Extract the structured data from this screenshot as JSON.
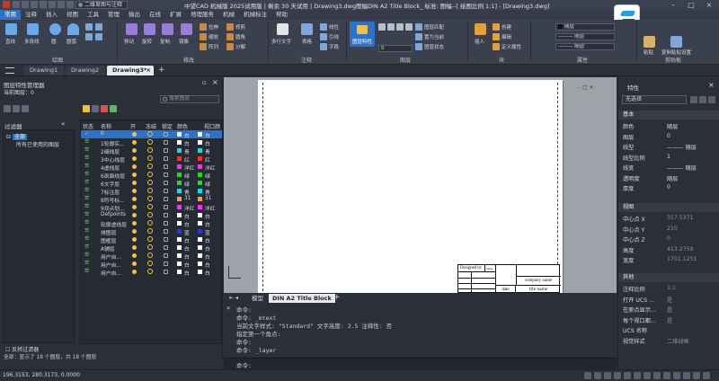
{
  "titlebar": {
    "workspace": "二维草图与注释",
    "title": "中望CAD 机械版 2025试用版 | 剩余 30 天试用 | Drawing3.dwg图幅DIN A2 Title Block_ 标准: 图幅--[ 绘图比例 1:1] - [Drawing3.dwg]"
  },
  "menu": [
    "常用",
    "注释",
    "插入",
    "视图",
    "工具",
    "管理",
    "输出",
    "在线",
    "扩展",
    "地理服务",
    "机械",
    "机械标注",
    "帮助"
  ],
  "ribbon": {
    "draw": {
      "label": "绘图",
      "buttons": [
        "直线",
        "多段线",
        "圆",
        "圆弧"
      ]
    },
    "modify": {
      "label": "修改",
      "buttons": [
        "移动",
        "旋转",
        "复制",
        "镜像",
        "拉伸",
        "缩放",
        "阵列",
        "修剪",
        "圆角",
        "分解"
      ]
    },
    "annotate": {
      "label": "注释",
      "buttons": [
        "多行文字",
        "表格",
        "线性",
        "引线",
        "字段"
      ]
    },
    "layers": {
      "label": "图层",
      "buttons": [
        "图层特性",
        "图层匹配",
        "置为当前",
        "图层状态"
      ],
      "current": "0"
    },
    "block": {
      "label": "块",
      "buttons": [
        "插入",
        "创建",
        "编辑",
        "定义属性"
      ]
    },
    "properties": {
      "label": "属性",
      "color": "随层",
      "linetype": "随层",
      "lineweight": "随层"
    },
    "clipboard": {
      "label": "剪贴板",
      "buttons": [
        "粘贴",
        "复制粘贴设置"
      ]
    }
  },
  "doc_tabs": [
    "Drawing1",
    "Drawing2",
    "Drawing3*"
  ],
  "layer_panel": {
    "title": "图层特性管理器",
    "current_layer_label": "当前图层：0",
    "search_placeholder": "搜索图层",
    "filters_label": "过滤器",
    "tree": [
      "全部",
      "所有已使用的图层"
    ],
    "invert_filter": "反转过滤器",
    "status": "全部：显示了 18 个图层，共 18 个图层",
    "columns": [
      "状态",
      "名称",
      "开",
      "冻结",
      "锁定",
      "颜色",
      "视口颜"
    ],
    "rows": [
      {
        "name": "0",
        "color": "白",
        "vp": "白",
        "swatch": "#ffffff",
        "vpswatch": "#ffffff"
      },
      {
        "name": "1轮廓实...",
        "color": "白",
        "vp": "白",
        "swatch": "#ffffff",
        "vpswatch": "#ffffff"
      },
      {
        "name": "2细线层",
        "color": "青",
        "vp": "青",
        "swatch": "#00e5e5",
        "vpswatch": "#00e5e5"
      },
      {
        "name": "3中心线层",
        "color": "红",
        "vp": "红",
        "swatch": "#ff2a2a",
        "vpswatch": "#ff2a2a"
      },
      {
        "name": "4虚线层",
        "color": "洋红",
        "vp": "洋红",
        "swatch": "#ff2aff",
        "vpswatch": "#ff2aff"
      },
      {
        "name": "6剖面线层",
        "color": "绿",
        "vp": "绿",
        "swatch": "#21d921",
        "vpswatch": "#21d921"
      },
      {
        "name": "6文字层",
        "color": "绿",
        "vp": "绿",
        "swatch": "#21d921",
        "vpswatch": "#21d921"
      },
      {
        "name": "7标注层",
        "color": "青",
        "vp": "青",
        "swatch": "#00e5e5",
        "vpswatch": "#00e5e5"
      },
      {
        "name": "8符号标...",
        "color": "31",
        "vp": "31",
        "swatch": "#ff9a4a",
        "vpswatch": "#ff9a4a"
      },
      {
        "name": "9双点划...",
        "color": "洋红",
        "vp": "洋红",
        "swatch": "#ff2aff",
        "vpswatch": "#ff2aff"
      },
      {
        "name": "Defpoints",
        "color": "白",
        "vp": "白",
        "swatch": "#ffffff",
        "vpswatch": "#ffffff"
      },
      {
        "name": "轮廓虚线层",
        "color": "白",
        "vp": "白",
        "swatch": "#ffffff",
        "vpswatch": "#ffffff"
      },
      {
        "name": "排图层",
        "color": "蓝",
        "vp": "蓝",
        "swatch": "#2233ff",
        "vpswatch": "#2233ff"
      },
      {
        "name": "图框层",
        "color": "白",
        "vp": "白",
        "swatch": "#ffffff",
        "vpswatch": "#ffffff"
      },
      {
        "name": "A辅层",
        "color": "白",
        "vp": "白",
        "swatch": "#ffffff",
        "vpswatch": "#ffffff"
      },
      {
        "name": "用户自...",
        "color": "白",
        "vp": "白",
        "swatch": "#ffffff",
        "vpswatch": "#ffffff"
      },
      {
        "name": "用户自...",
        "color": "白",
        "vp": "白",
        "swatch": "#ffffff",
        "vpswatch": "#ffffff"
      },
      {
        "name": "用户自...",
        "color": "白",
        "vp": "白",
        "swatch": "#ffffff",
        "vpswatch": "#ffffff"
      }
    ]
  },
  "title_block": {
    "designed_by": "Designed by",
    "date": "date",
    "company": "company name",
    "file_name": "file name"
  },
  "layout_tabs": [
    "模型",
    "DIN A2 Title Block"
  ],
  "command": {
    "lines": [
      "命令:",
      "命令: _mtext",
      "当前文字样式: \"Standard\"  文字高度: 2.5 注释性: 否",
      "指定第一个角点:",
      "命令:",
      "命令: _layer"
    ],
    "prompt": "命令:"
  },
  "properties": {
    "title": "特性",
    "selection": "无选择",
    "sections": {
      "basic": "基本",
      "view": "视图",
      "misc": "其他"
    },
    "basic": [
      {
        "k": "颜色",
        "v": "随层"
      },
      {
        "k": "图层",
        "v": "0"
      },
      {
        "k": "线型",
        "v": "——— 随层"
      },
      {
        "k": "线型比例",
        "v": "1"
      },
      {
        "k": "线宽",
        "v": "——— 随层"
      },
      {
        "k": "透明度",
        "v": "随层"
      },
      {
        "k": "厚度",
        "v": "0"
      }
    ],
    "view": [
      {
        "k": "中心点 X",
        "v": "317.5371"
      },
      {
        "k": "中心点 Y",
        "v": "210"
      },
      {
        "k": "中心点 Z",
        "v": "0"
      },
      {
        "k": "高度",
        "v": "413.2759"
      },
      {
        "k": "宽度",
        "v": "1701.1251"
      }
    ],
    "misc": [
      {
        "k": "注释比例",
        "v": "1:1"
      },
      {
        "k": "打开 UCS ...",
        "v": "是"
      },
      {
        "k": "在原点显示...",
        "v": "是"
      },
      {
        "k": "每个视口都...",
        "v": "是"
      },
      {
        "k": "UCS 名称",
        "v": ""
      },
      {
        "k": "视觉样式",
        "v": "二维线框"
      }
    ]
  },
  "statusbar": {
    "coords": "196.3153, 280.3173, 0.0000"
  },
  "colors": {
    "accent": "#2b73c8",
    "panel": "#2b2f38",
    "ribbon": "#3a404d"
  }
}
